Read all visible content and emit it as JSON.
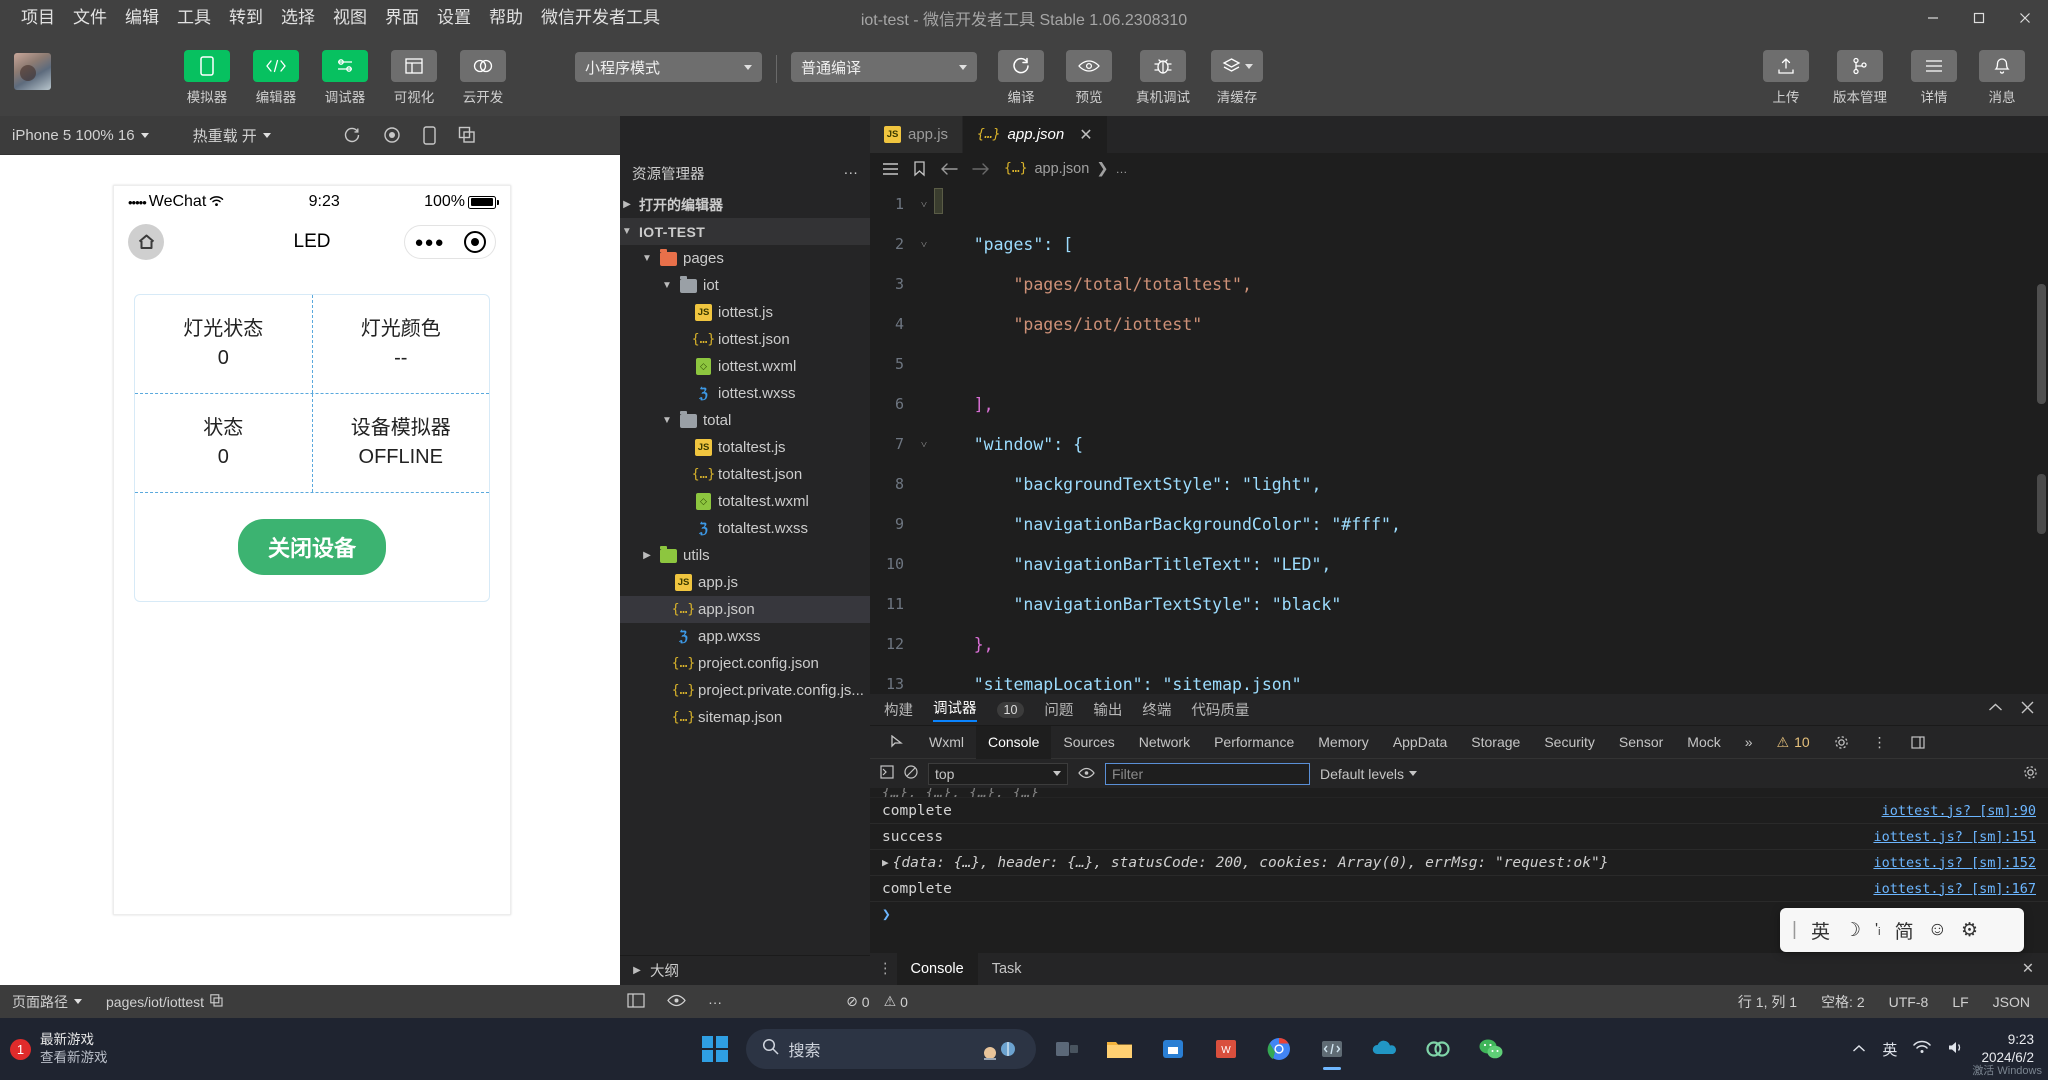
{
  "titlebar": {
    "menus": [
      "项目",
      "文件",
      "编辑",
      "工具",
      "转到",
      "选择",
      "视图",
      "界面",
      "设置",
      "帮助",
      "微信开发者工具"
    ],
    "window_title": "iot-test - 微信开发者工具 Stable 1.06.2308310",
    "minimize": "—",
    "maximize": "▢",
    "close": "✕"
  },
  "toolbar": {
    "buttons": [
      {
        "label": "模拟器",
        "icon": "phone-icon",
        "active": true
      },
      {
        "label": "编辑器",
        "icon": "code-icon",
        "active": true
      },
      {
        "label": "调试器",
        "icon": "sliders-icon",
        "active": true
      },
      {
        "label": "可视化",
        "icon": "layout-icon",
        "active": false
      },
      {
        "label": "云开发",
        "icon": "cloud-icon",
        "active": false
      }
    ],
    "mode_select": "小程序模式",
    "compile_select": "普通编译",
    "actions": [
      {
        "label": "编译",
        "icon": "refresh-icon"
      },
      {
        "label": "预览",
        "icon": "eye-icon"
      },
      {
        "label": "真机调试",
        "icon": "bug-icon"
      },
      {
        "label": "清缓存",
        "icon": "layers-icon"
      }
    ],
    "right_actions": [
      {
        "label": "上传",
        "icon": "upload-icon"
      },
      {
        "label": "版本管理",
        "icon": "branch-icon"
      },
      {
        "label": "详情",
        "icon": "menu-icon"
      },
      {
        "label": "消息",
        "icon": "bell-icon"
      }
    ]
  },
  "simulator": {
    "device_select": "iPhone 5 100% 16",
    "hot_reload": "热重载 开",
    "toolbar_icons": [
      "rotate-icon",
      "record-icon",
      "device-icon",
      "copy-icon"
    ],
    "status_bar": {
      "carrier": "WeChat",
      "dots": "•••••",
      "time": "9:23",
      "battery": "100%"
    },
    "nav_title": "LED",
    "cells": [
      {
        "label": "灯光状态",
        "value": "0"
      },
      {
        "label": "灯光颜色",
        "value": "--"
      },
      {
        "label": "状态",
        "value": "0"
      },
      {
        "label": "设备模拟器",
        "value": "OFFLINE"
      }
    ],
    "action_button": "关闭设备"
  },
  "explorer": {
    "title": "资源管理器",
    "more": "···",
    "toolbar_icons": [
      "files-icon",
      "search-icon",
      "source-control-icon",
      "extensions-icon",
      "debug-icon",
      "eye-icon"
    ],
    "sections": [
      {
        "label": "打开的编辑器",
        "collapsed": true
      },
      {
        "label": "IOT-TEST",
        "collapsed": false
      }
    ],
    "tree": [
      {
        "label": "pages",
        "type": "folder",
        "color": "red",
        "depth": 1,
        "open": true
      },
      {
        "label": "iot",
        "type": "folder",
        "color": "grey",
        "depth": 2,
        "open": true
      },
      {
        "label": "iottest.js",
        "type": "js",
        "depth": 3
      },
      {
        "label": "iottest.json",
        "type": "json",
        "depth": 3
      },
      {
        "label": "iottest.wxml",
        "type": "wxml",
        "depth": 3
      },
      {
        "label": "iottest.wxss",
        "type": "wxss",
        "depth": 3
      },
      {
        "label": "total",
        "type": "folder",
        "color": "grey",
        "depth": 2,
        "open": true
      },
      {
        "label": "totaltest.js",
        "type": "js",
        "depth": 3
      },
      {
        "label": "totaltest.json",
        "type": "json",
        "depth": 3
      },
      {
        "label": "totaltest.wxml",
        "type": "wxml",
        "depth": 3
      },
      {
        "label": "totaltest.wxss",
        "type": "wxss",
        "depth": 3
      },
      {
        "label": "utils",
        "type": "folder",
        "color": "green",
        "depth": 1,
        "open": false
      },
      {
        "label": "app.js",
        "type": "js",
        "depth": 2
      },
      {
        "label": "app.json",
        "type": "json",
        "depth": 2,
        "selected": true
      },
      {
        "label": "app.wxss",
        "type": "wxss",
        "depth": 2
      },
      {
        "label": "project.config.json",
        "type": "json",
        "depth": 2
      },
      {
        "label": "project.private.config.js...",
        "type": "json",
        "depth": 2
      },
      {
        "label": "sitemap.json",
        "type": "json",
        "depth": 2
      }
    ],
    "outline": "大纲"
  },
  "editor": {
    "tabs": [
      {
        "label": "app.js",
        "type": "js",
        "active": false
      },
      {
        "label": "app.json",
        "type": "json",
        "active": true,
        "close": "✕"
      }
    ],
    "breadcrumb": "app.json",
    "breadcrumb_sep": "❯",
    "breadcrumb_tail": "…",
    "lines": [
      {
        "n": "1",
        "fold": "˅",
        "text": "{"
      },
      {
        "n": "2",
        "fold": "˅",
        "text": "    \"pages\": ["
      },
      {
        "n": "3",
        "fold": "",
        "text": "        \"pages/total/totaltest\","
      },
      {
        "n": "4",
        "fold": "",
        "text": "        \"pages/iot/iottest\""
      },
      {
        "n": "5",
        "fold": "",
        "text": ""
      },
      {
        "n": "6",
        "fold": "",
        "text": "    ],"
      },
      {
        "n": "7",
        "fold": "˅",
        "text": "    \"window\": {"
      },
      {
        "n": "8",
        "fold": "",
        "text": "        \"backgroundTextStyle\": \"light\","
      },
      {
        "n": "9",
        "fold": "",
        "text": "        \"navigationBarBackgroundColor\": \"#fff\","
      },
      {
        "n": "10",
        "fold": "",
        "text": "        \"navigationBarTitleText\": \"LED\","
      },
      {
        "n": "11",
        "fold": "",
        "text": "        \"navigationBarTextStyle\": \"black\""
      },
      {
        "n": "12",
        "fold": "",
        "text": "    },"
      },
      {
        "n": "13",
        "fold": "",
        "text": "    \"sitemapLocation\": \"sitemap.json\""
      }
    ]
  },
  "devtools": {
    "head_tabs": [
      {
        "label": "构建",
        "active": false
      },
      {
        "label": "调试器",
        "active": true,
        "badge": "10"
      },
      {
        "label": "问题",
        "active": false
      },
      {
        "label": "输出",
        "active": false
      },
      {
        "label": "终端",
        "active": false
      },
      {
        "label": "代码质量",
        "active": false
      }
    ],
    "head_actions": [
      "chevron-up-icon",
      "close-icon"
    ],
    "panel_tabs": [
      "Wxml",
      "Console",
      "Sources",
      "Network",
      "Performance",
      "Memory",
      "AppData",
      "Storage",
      "Security",
      "Sensor",
      "Mock"
    ],
    "panel_active": "Console",
    "overflow": "»",
    "warning_count": "10",
    "filter": {
      "context": "top",
      "placeholder": "Filter",
      "levels": "Default levels"
    },
    "console_rows": [
      {
        "text": "complete",
        "source": "iottest.js? [sm]:90"
      },
      {
        "text": "success",
        "source": "iottest.js? [sm]:151"
      },
      {
        "text": "{data: {…}, header: {…}, statusCode: 200, cookies: Array(0), errMsg: \"request:ok\"}",
        "source": "iottest.js? [sm]:152",
        "expandable": true
      },
      {
        "text": "complete",
        "source": "iottest.js? [sm]:167"
      }
    ],
    "prompt": "❯",
    "bottom_tabs": [
      {
        "label": "Console",
        "active": true
      },
      {
        "label": "Task",
        "active": false
      }
    ],
    "bottom_close": "✕"
  },
  "ime": {
    "items": [
      "英",
      "☽",
      "'ᵢ",
      "简",
      "☺",
      "⚙"
    ]
  },
  "statusbar": {
    "page_path_label": "页面路径",
    "page_path": "pages/iot/iottest",
    "copy_icon": "copy-icon",
    "left_icons": [
      "layout-icon",
      "eye-icon",
      "more-icon"
    ],
    "errors": "0",
    "warnings": "0",
    "position": "行 1, 列 1",
    "spaces": "空格: 2",
    "encoding": "UTF-8",
    "eol": "LF",
    "language": "JSON"
  },
  "taskbar": {
    "news_badge": "1",
    "news_title": "最新游戏",
    "news_sub": "查看新游戏",
    "search_placeholder": "搜索",
    "apps": [
      "windows-icon",
      "task-view-icon",
      "file-explorer-icon",
      "store-icon",
      "wps-icon",
      "chrome-icon",
      "devtools-icon",
      "onedrive-icon",
      "link-icon",
      "wechat-icon"
    ],
    "tray": [
      "chevron-up-icon",
      "英",
      "wifi-icon",
      "volume-icon"
    ],
    "clock_time": "9:23",
    "clock_date": "2024/6/2",
    "watermark": "激活 Windows"
  },
  "colors": {
    "accent_green": "#07c160",
    "button_green": "#3cb371",
    "editor_bg": "#1e1e1e",
    "chrome": "#414141",
    "taskbar": "#1f2430"
  }
}
